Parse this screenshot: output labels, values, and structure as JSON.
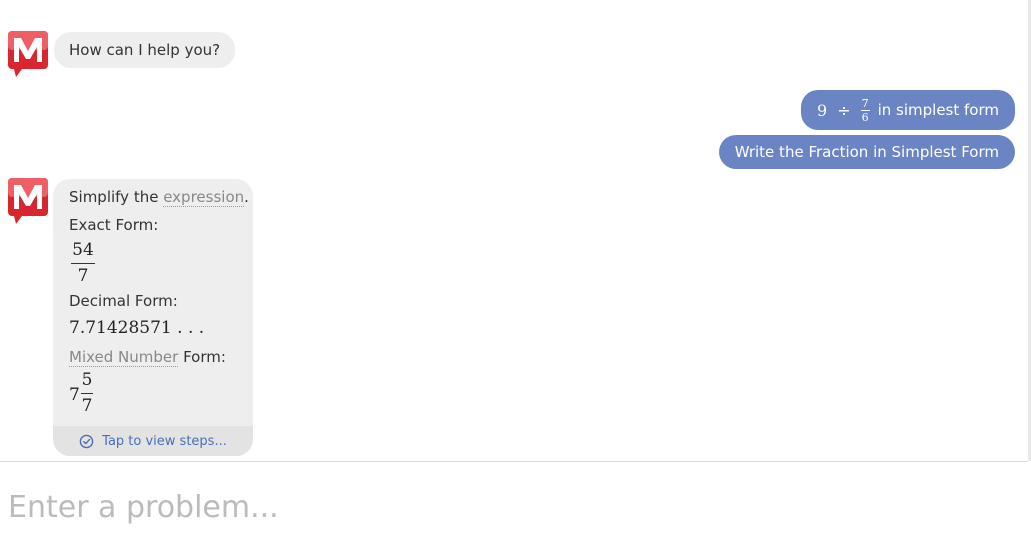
{
  "bot": {
    "greeting": "How can I help you?",
    "avatar_icon": "mathway-logo-icon"
  },
  "user": {
    "question": {
      "whole": "9",
      "operator": "÷",
      "fraction_num": "7",
      "fraction_den": "6",
      "suffix": "in simplest form"
    },
    "command": "Write the Fraction in Simplest Form"
  },
  "answer": {
    "intro_prefix": "Simplify the ",
    "intro_link": "expression",
    "intro_suffix": ".",
    "exact_label": "Exact Form:",
    "exact_num": "54",
    "exact_den": "7",
    "decimal_label": "Decimal Form:",
    "decimal_value": "7.71428571 . . .",
    "mixed_link": "Mixed Number",
    "mixed_label_suffix": " Form:",
    "mixed_whole": "7",
    "mixed_num": "5",
    "mixed_den": "7",
    "steps_label": "Tap to view steps..."
  },
  "input": {
    "placeholder": "Enter a problem..."
  },
  "colors": {
    "user_bubble": "#6b85c4",
    "bot_bubble": "#eeeeee",
    "logo_red": "#d9252e",
    "steps_link": "#4a6fb5"
  }
}
